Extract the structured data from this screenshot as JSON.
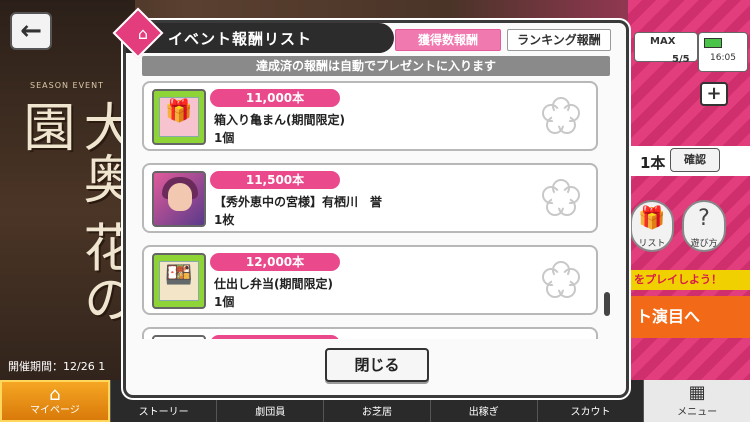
{
  "background": {
    "season_label": "SEASON EVENT",
    "event_title": "大奥 花の園",
    "period": "開催期間：12/26 1",
    "max_label": "MAX",
    "stamina": "5/5",
    "clock": "16:05",
    "item_count": "1本",
    "confirm_label": "確認",
    "reward_list_label": "リスト",
    "help_label": "遊び方",
    "play_banner": "をプレイしよう！",
    "play_button": "ト演目へ"
  },
  "modal": {
    "title": "イベント報酬リスト",
    "tab_count": "獲得数報酬",
    "tab_ranking": "ランキング報酬",
    "notice": "達成済の報酬は自動でプレゼントに入ります",
    "close_label": "閉じる",
    "rewards": [
      {
        "amount": "11,000本",
        "name": "箱入り亀まん(期間限定)",
        "qty": "1個",
        "thumb": "green-box"
      },
      {
        "amount": "11,500本",
        "name": "【秀外恵中の宮様】有栖川　誉",
        "qty": "1枚",
        "thumb": "card"
      },
      {
        "amount": "12,000本",
        "name": "仕出し弁当(期間限定)",
        "qty": "1個",
        "thumb": "green-bento"
      },
      {
        "amount": "",
        "name": "",
        "qty": "",
        "thumb": "partial"
      }
    ]
  },
  "nav": [
    {
      "label": "マイページ",
      "icon": "home-icon"
    },
    {
      "label": "ストーリー",
      "icon": "book-icon"
    },
    {
      "label": "劇団員",
      "icon": "members-icon"
    },
    {
      "label": "お芝居",
      "icon": "stage-icon"
    },
    {
      "label": "出稼ぎ",
      "icon": "work-icon"
    },
    {
      "label": "スカウト",
      "icon": "scout-icon"
    },
    {
      "label": "メニュー",
      "icon": "menu-grid-icon"
    }
  ],
  "colors": {
    "accent_pink": "#ea4a8b",
    "header_dark": "#2c2c2c",
    "tab_active": "#f07ab0",
    "notice_gray": "#8a8a8a"
  }
}
